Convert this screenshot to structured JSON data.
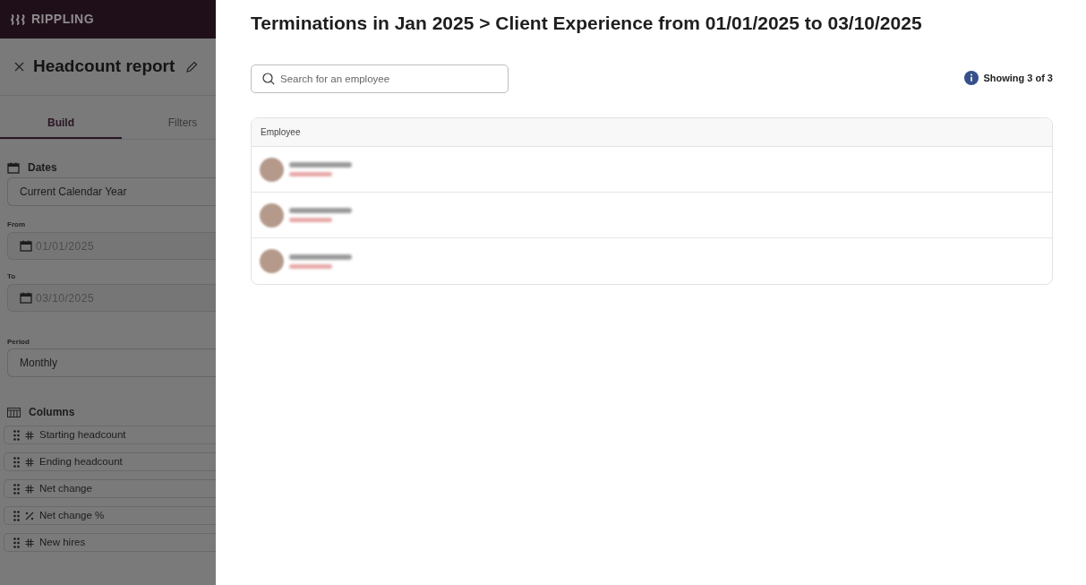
{
  "sidebar": {
    "logo": "RIPPLING",
    "title": "Headcount report",
    "tabs": [
      {
        "label": "Build",
        "selected": true
      },
      {
        "label": "Filters",
        "selected": false
      }
    ],
    "dates": {
      "heading": "Dates",
      "range": "Current Calendar Year",
      "from_label": "From",
      "from": "01/01/2025",
      "to_label": "To",
      "to": "03/10/2025"
    },
    "period": {
      "label": "Period",
      "value": "Monthly"
    },
    "columns": {
      "heading": "Columns",
      "items": [
        {
          "kind": "number",
          "label": "Starting headcount"
        },
        {
          "kind": "number",
          "label": "Ending headcount"
        },
        {
          "kind": "number",
          "label": "Net change"
        },
        {
          "kind": "percent",
          "label": "Net change %"
        },
        {
          "kind": "number",
          "label": "New hires"
        }
      ]
    }
  },
  "panel": {
    "title": "Terminations in Jan 2025 > Client Experience from 01/01/2025 to 03/10/2025",
    "search": {
      "placeholder": "Search for an employee"
    },
    "count": "Showing 3 of 3",
    "table": {
      "columns": [
        "Employee"
      ],
      "rows": [
        {
          "kind": "redacted"
        },
        {
          "kind": "redacted"
        },
        {
          "kind": "redacted"
        }
      ]
    }
  }
}
